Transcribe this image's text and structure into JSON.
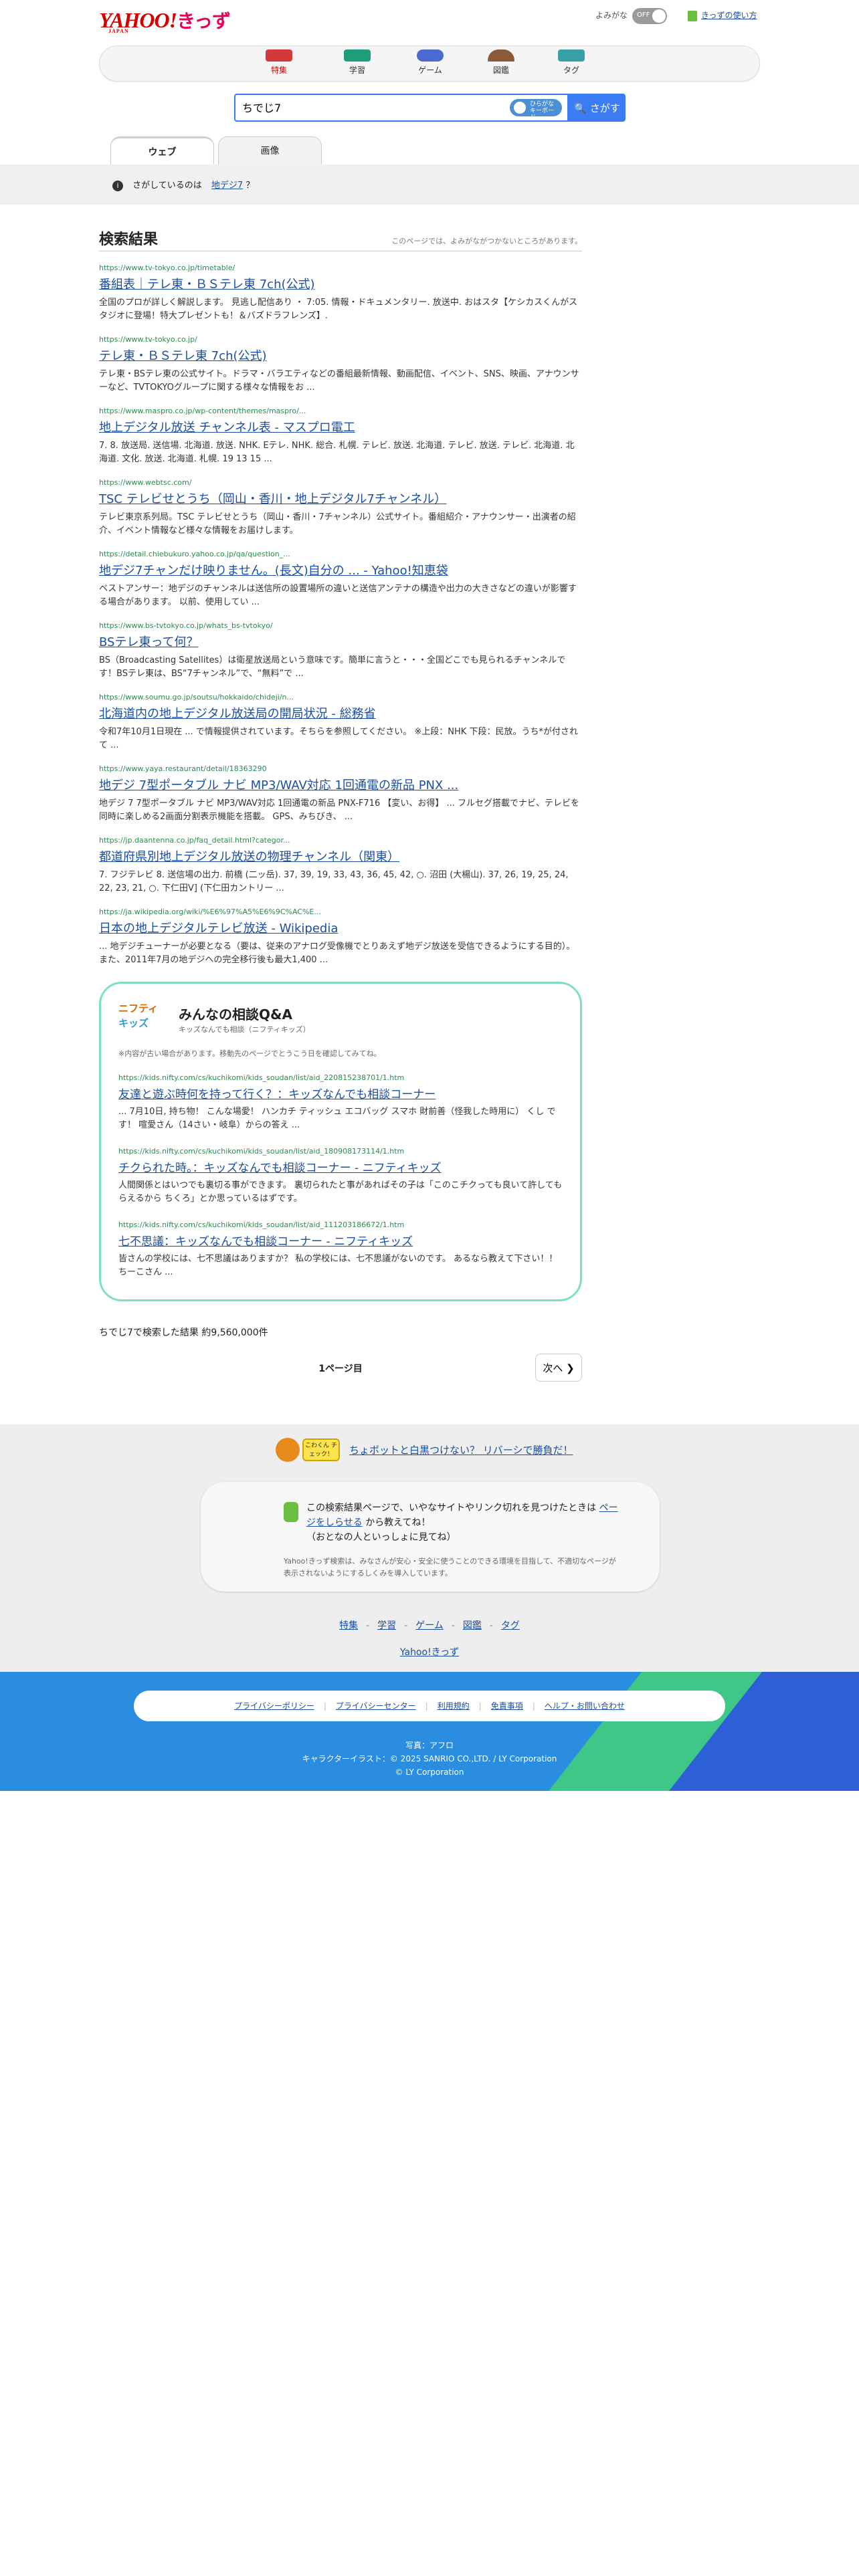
{
  "header": {
    "logo": "YAHOO!",
    "logo_kids": "きっず",
    "logo_japan": "JAPAN",
    "yomigana_label": "よみがな",
    "toggle_state": "OFF",
    "howto_link": "きっずの使い方"
  },
  "categories": [
    {
      "label": "特集",
      "color": "#d23a3a",
      "active": true
    },
    {
      "label": "学習",
      "color": "#1f9c7a",
      "active": false
    },
    {
      "label": "ゲーム",
      "color": "#4a6ad0",
      "active": false
    },
    {
      "label": "図鑑",
      "color": "#8a5a3a",
      "active": false
    },
    {
      "label": "タグ",
      "color": "#3aa0a8",
      "active": false
    }
  ],
  "search": {
    "query": "ちでじ7",
    "keyboard_label": "ひらがな キーボード",
    "button_label": "さがす"
  },
  "tabs": [
    "ウェブ",
    "画像"
  ],
  "info": {
    "prefix": "さがしているのは",
    "suggestion": "地デジ7",
    "suffix": "？"
  },
  "results_header": {
    "title": "検索結果",
    "note": "このページでは、よみがながつかないところがあります。"
  },
  "results": [
    {
      "url": "https://www.tv-tokyo.co.jp/timetable/",
      "title": "番組表｜テレ東・ＢＳテレ東 7ch(公式)",
      "desc": "全国のプロが詳しく解説します。 見逃し配信あり ・ 7:05. 情報・ドキュメンタリー. 放送中. おはスタ【ケシカスくんがスタジオに登場！特大プレゼントも！＆バズドラフレンズ】."
    },
    {
      "url": "https://www.tv-tokyo.co.jp/",
      "title": "テレ東・ＢＳテレ東 7ch(公式)",
      "desc": "テレ東・BSテレ東の公式サイト。ドラマ・バラエティなどの番組最新情報、動画配信、イベント、SNS、映画、アナウンサーなど、TVTOKYOグループに関する様々な情報をお ..."
    },
    {
      "url": "https://www.maspro.co.jp/wp-content/themes/maspro/...",
      "title": "地上デジタル放送 チャンネル表 - マスプロ電工",
      "desc": "7. 8. 放送局. 送信場. 北海道. 放送. NHK. Eテレ. NHK. 総合. 札幌. テレビ. 放送. 北海道. テレビ. 放送. テレビ. 北海道. 北海道. 文化. 放送. 北海道. 札幌. 19 13 15 ..."
    },
    {
      "url": "https://www.webtsc.com/",
      "title": "TSC テレビせとうち（岡山・香川・地上デジタル7チャンネル）",
      "desc": "テレビ東京系列局。TSC テレビせとうち（岡山・香川・7チャンネル）公式サイト。番組紹介・アナウンサー・出演者の紹介、イベント情報など様々な情報をお届けします。"
    },
    {
      "url": "https://detail.chiebukuro.yahoo.co.jp/qa/question_...",
      "title": "地デジ7チャンだけ映りません。(長文)自分の ... - Yahoo!知恵袋",
      "desc": "ベストアンサー：地デジのチャンネルは送信所の設置場所の違いと送信アンテナの構造や出力の大きさなどの違いが影響する場合があります。 以前、使用してい ..."
    },
    {
      "url": "https://www.bs-tvtokyo.co.jp/whats_bs-tvtokyo/",
      "title": "BSテレ東って何？",
      "desc": "BS（Broadcasting Satellites）は衛星放送局という意味です。簡単に言うと・・・全国どこでも見られるチャンネルです！BSテレ東は、BS“7チャンネル”で、“無料”で ..."
    },
    {
      "url": "https://www.soumu.go.jp/soutsu/hokkaido/chideji/n...",
      "title": "北海道内の地上デジタル放送局の開局状況 - 総務省",
      "desc": "令和7年10月1日現在 ... で情報提供されています。そちらを参照してください。 ※上段：NHK 下段：民放。うち*が付されて ..."
    },
    {
      "url": "https://www.yaya.restaurant/detail/18363290",
      "title": "地デジ 7型ポータブル ナビ MP3/WAV対応 1回通電の新品 PNX ...",
      "desc": "地デジ 7 7型ポータブル ナビ MP3/WAV対応 1回通電の新品 PNX-F716 【変い、お得】 ... フルセグ搭載でナビ、テレビを同時に楽しめる2画面分割表示機能を搭載。 GPS、みちびき、 ..."
    },
    {
      "url": "https://jp.daantenna.co.jp/faq_detail.html?categor...",
      "title": "都道府県別地上デジタル放送の物理チャンネル（関東）",
      "desc": "7. フジテレビ 8. 送信場の出力. 前橋 (二ッ岳). 37, 39, 19, 33, 43, 36, 45, 42, ○. 沼田 (大楊山). 37, 26, 19, 25, 24, 22, 23, 21, ○. 下仁田V] (下仁田カントリー ..."
    },
    {
      "url": "https://ja.wikipedia.org/wiki/%E6%97%A5%E6%9C%AC%E...",
      "title": "日本の地上デジタルテレビ放送 - Wikipedia",
      "desc": "... 地デジチューナーが必要となる（要は、従来のアナログ受像機でとりあえず地デジ放送を受信できるようにする目的）。また、2011年7月の地デジへの完全移行後も最大1,400 ..."
    }
  ],
  "qa": {
    "logo_line1": "ニフティ",
    "logo_line2": "キッズ",
    "name": "みんなの相談Q&A",
    "sub": "キッズなんでも相談（ニフティキッズ）",
    "caution": "※内容が古い場合があります。移動先のページでとうこう日を確認してみてね。",
    "items": [
      {
        "url": "https://kids.nifty.com/cs/kuchikomi/kids_soudan/list/aid_220815238701/1.htm",
        "title": "友達と遊ぶ時何を持って行く？：キッズなんでも相談コーナー",
        "desc": "... 7月10日, 持ち物！ こんな場愛！ ハンカチ ティッシュ エコバッグ スマホ 財前善（怪我した時用に） くし です！ 喧愛さん（14さい・岐阜）からの答え ..."
      },
      {
        "url": "https://kids.nifty.com/cs/kuchikomi/kids_soudan/list/aid_180908173114/1.htm",
        "title": "チクられた時。：キッズなんでも相談コーナー - ニフティキッズ",
        "desc": "人間関係とはいつでも裏切る事ができます。 裏切られたと事があればその子は「このこチクっても良いて許してもらえるから ちくろ」とか思っているはずです。"
      },
      {
        "url": "https://kids.nifty.com/cs/kuchikomi/kids_soudan/list/aid_111203186672/1.htm",
        "title": "七不思議：キッズなんでも相談コーナー - ニフティキッズ",
        "desc": "皆さんの学校には、七不思議はありますか？ 私の学校には、七不思議がないのです。 あるなら教えて下さい！！ ちーこさん ..."
      }
    ]
  },
  "count_text": "ちでじ7で検索した結果 約9,560,000件",
  "pager": {
    "page": "1ページ目",
    "next": "次へ ❯"
  },
  "report": {
    "bubble": "こわくん チェック！",
    "link": "ちょボットと白黒つけない？ リバーシで勝負だ！"
  },
  "card": {
    "msg_before": "この検索結果ページで、いやなサイトやリンク切れを見つけたときは",
    "msg_link": "ページをしらせる",
    "msg_after": "から教えてね！",
    "msg_line2": "（おとなの人といっしょに見てね）",
    "small": "Yahoo!きっず検索は、みなさんが安心・安全に使うことのできる環境を目指して、不適切なページが表示されないようにするしくみを導入しています。"
  },
  "footer_links": [
    "特集",
    "学習",
    "ゲーム",
    "図鑑",
    "タグ"
  ],
  "footer_home": "Yahoo!きっず",
  "legal_links": [
    "プライバシーポリシー",
    "プライバシーセンター",
    "利用規約",
    "免責事項",
    "ヘルプ・お問い合わせ"
  ],
  "copyright": {
    "line1": "写真：アフロ",
    "line2": "キャラクターイラスト：© 2025 SANRIO CO.,LTD. / LY Corporation",
    "line3": "© LY Corporation"
  }
}
